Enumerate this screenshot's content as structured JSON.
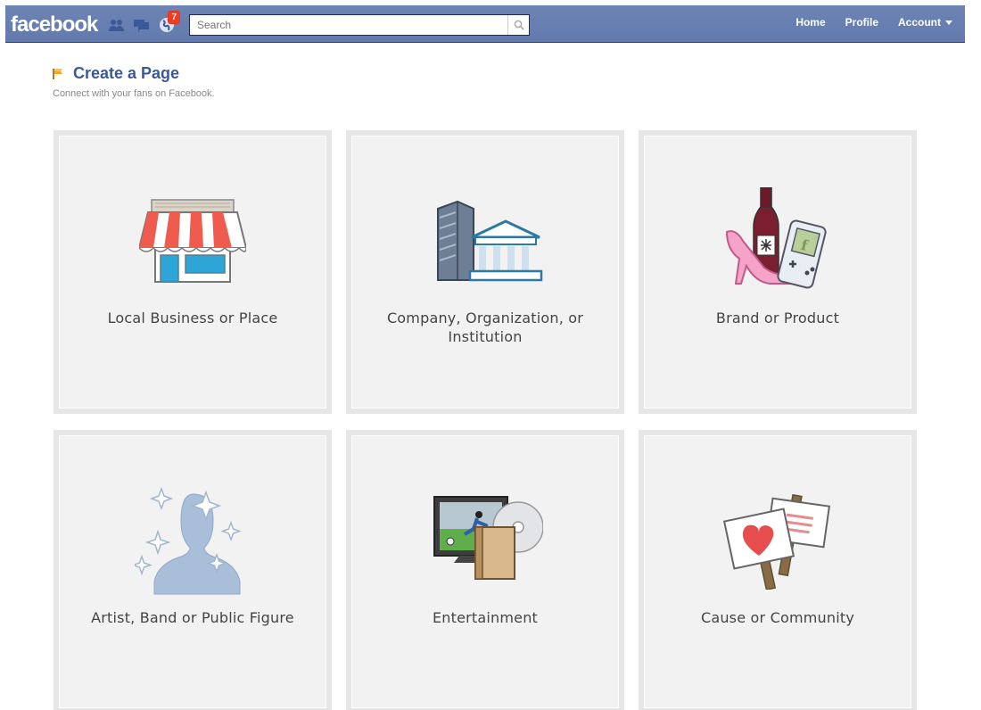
{
  "topbar": {
    "logo": "facebook",
    "notification_count": "7",
    "search_placeholder": "Search",
    "nav": {
      "home": "Home",
      "profile": "Profile",
      "account": "Account"
    },
    "icons": [
      "friend-requests-icon",
      "messages-icon",
      "notifications-icon"
    ]
  },
  "header": {
    "title": "Create a Page",
    "subtitle": "Connect with your fans on Facebook."
  },
  "categories": [
    {
      "label": "Local Business or Place",
      "icon": "storefront-icon"
    },
    {
      "label": "Company, Organization, or Institution",
      "icon": "buildings-icon"
    },
    {
      "label": "Brand or Product",
      "icon": "products-icon"
    },
    {
      "label": "Artist, Band or Public Figure",
      "icon": "silhouette-icon"
    },
    {
      "label": "Entertainment",
      "icon": "tv-media-icon"
    },
    {
      "label": "Cause or Community",
      "icon": "signs-icon"
    }
  ],
  "colors": {
    "brand": "#3b5998",
    "bar": "#6d84b4",
    "badge": "#f03d25"
  }
}
